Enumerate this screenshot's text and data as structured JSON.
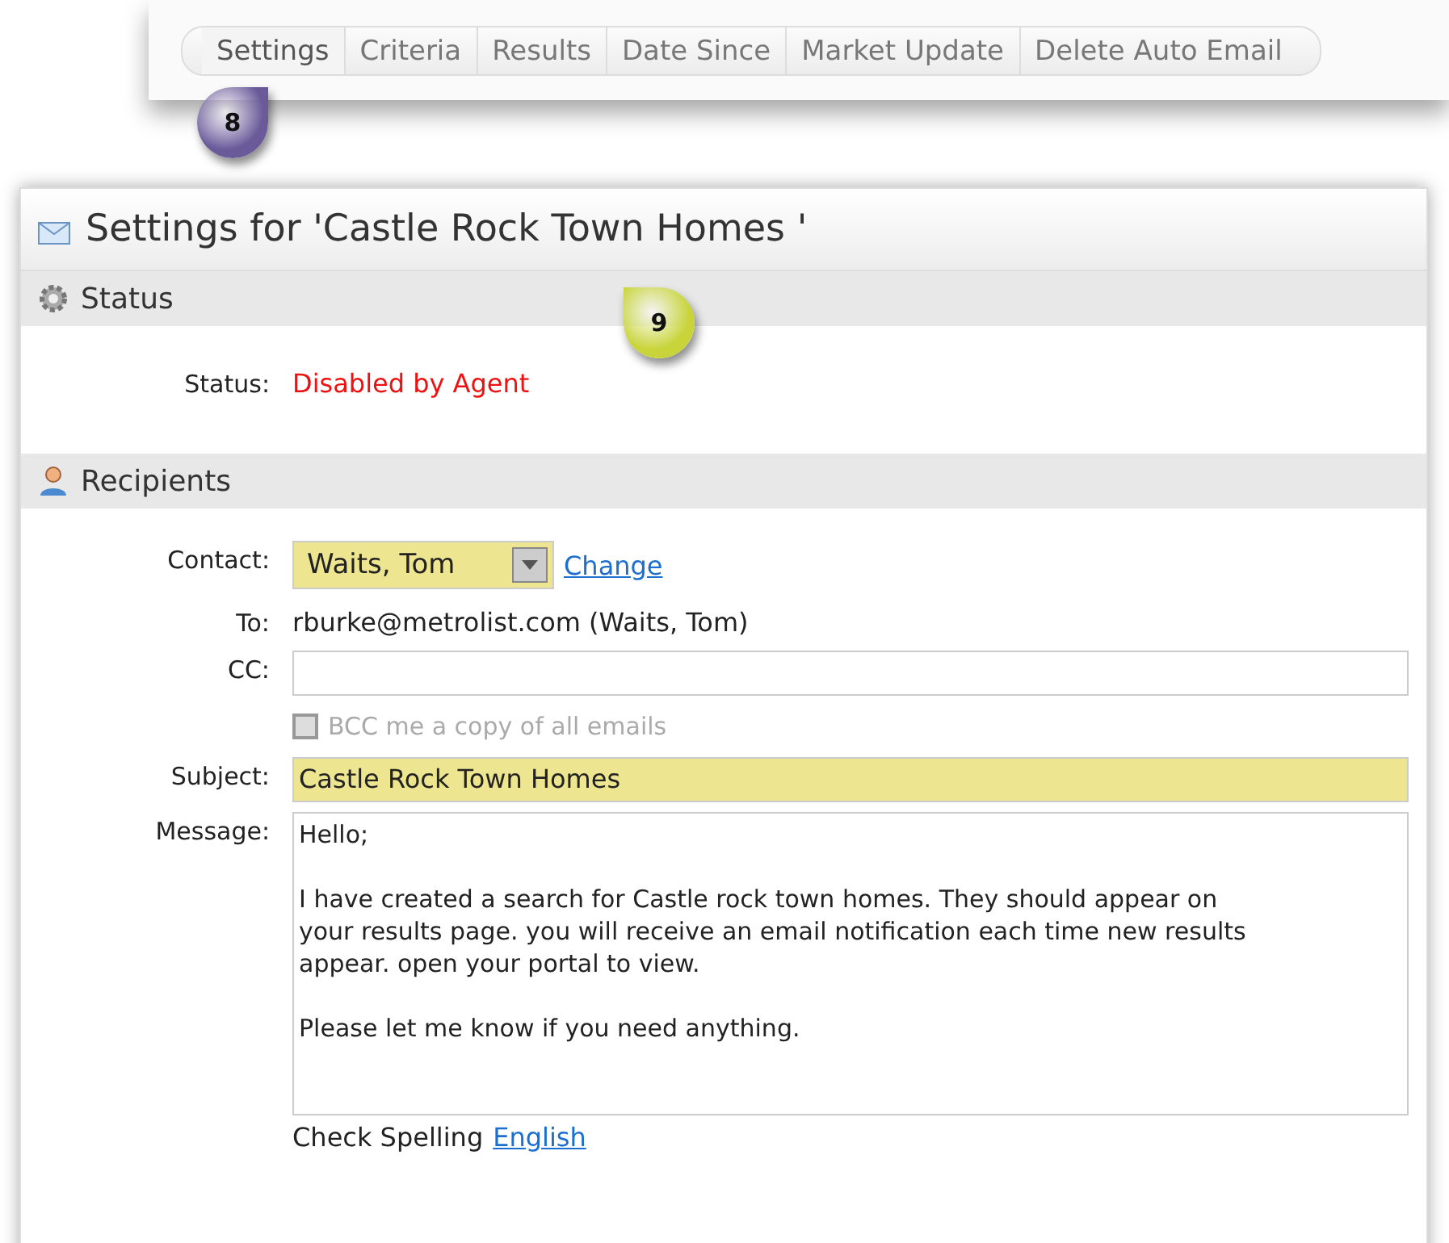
{
  "tabs": [
    {
      "label": "Settings",
      "selected": true
    },
    {
      "label": "Criteria",
      "selected": false
    },
    {
      "label": "Results",
      "selected": false
    },
    {
      "label": "Date Since",
      "selected": false
    },
    {
      "label": "Market Update",
      "selected": false
    },
    {
      "label": "Delete Auto Email",
      "selected": false
    }
  ],
  "callouts": [
    {
      "number": "8",
      "color": "#6a5a9a"
    },
    {
      "number": "9",
      "color": "#c8d43a"
    }
  ],
  "title": "Settings for 'Castle Rock Town Homes '",
  "status_section": {
    "heading": "Status",
    "label": "Status:",
    "value": "Disabled by Agent"
  },
  "recipients_section": {
    "heading": "Recipients",
    "contact": {
      "label": "Contact:",
      "value": "Waits, Tom",
      "link": "Change"
    },
    "to": {
      "label": "To:",
      "value": "rburke@metrolist.com (Waits, Tom)"
    },
    "cc": {
      "label": "CC:"
    },
    "bcc": {
      "label": "BCC me a copy of all emails",
      "checked": false,
      "disabled": true
    },
    "subject": {
      "label": "Subject:",
      "value": "Castle Rock Town Homes"
    },
    "message": {
      "label": "Message:",
      "paragraphs": [
        [
          "Hello;"
        ],
        [
          "I have created a search for Castle rock town homes. They should appear on",
          "your results page. you will receive an email notification each time new results",
          "appear. open your portal to view."
        ],
        [
          "Please let me know if you need anything."
        ]
      ]
    },
    "spelling": {
      "label": "Check Spelling",
      "link": "English"
    }
  }
}
